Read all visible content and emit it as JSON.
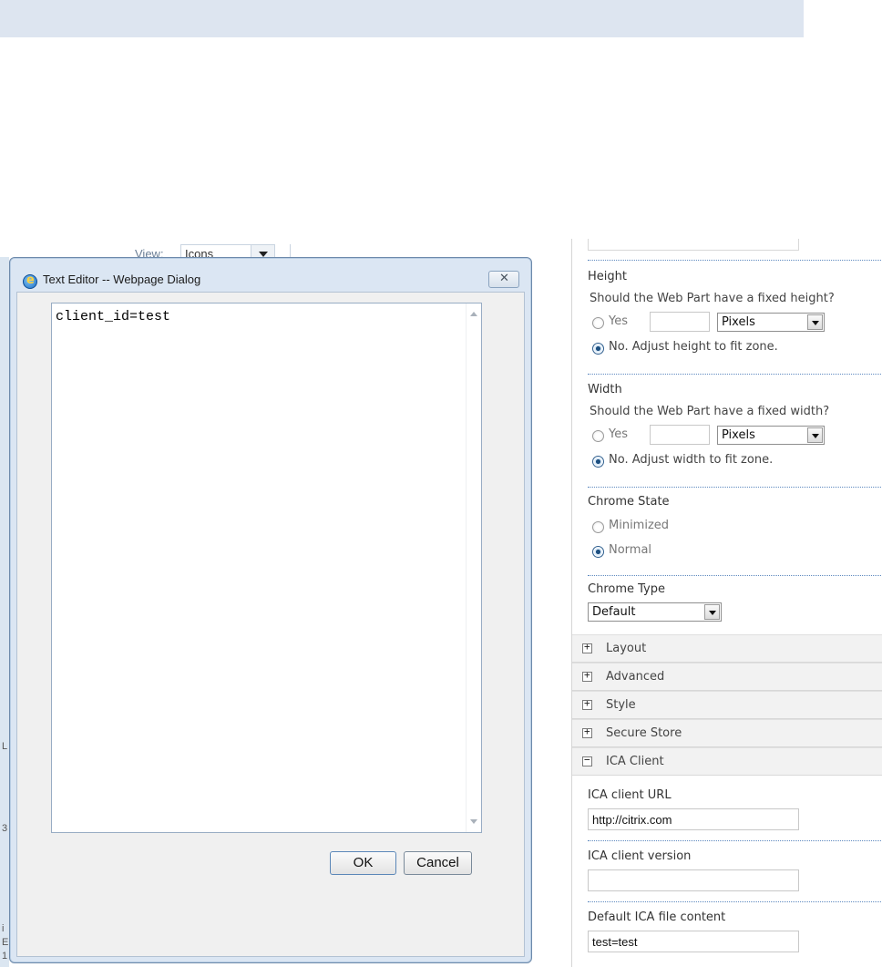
{
  "background": {
    "view_label": "View:",
    "view_value": "Icons",
    "edge_chars": [
      "L",
      "3",
      "i",
      "E",
      "1"
    ]
  },
  "dialog": {
    "title": "Text Editor -- Webpage Dialog",
    "close_label": "✕",
    "content": "client_id=test",
    "ok_label": "OK",
    "cancel_label": "Cancel"
  },
  "panel": {
    "height": {
      "heading": "Height",
      "question": "Should the Web Part have a fixed height?",
      "yes_label": "Yes",
      "unit": "Pixels",
      "no_label": "No. Adjust height to fit zone.",
      "selected": "no"
    },
    "width": {
      "heading": "Width",
      "question": "Should the Web Part have a fixed width?",
      "yes_label": "Yes",
      "unit": "Pixels",
      "no_label": "No. Adjust width to fit zone.",
      "selected": "no"
    },
    "chrome_state": {
      "heading": "Chrome State",
      "minimized_label": "Minimized",
      "normal_label": "Normal",
      "selected": "normal"
    },
    "chrome_type": {
      "heading": "Chrome Type",
      "value": "Default"
    },
    "sections": [
      {
        "symbol": "+",
        "label": "Layout"
      },
      {
        "symbol": "+",
        "label": "Advanced"
      },
      {
        "symbol": "+",
        "label": "Style"
      },
      {
        "symbol": "+",
        "label": "Secure Store"
      },
      {
        "symbol": "−",
        "label": "ICA Client"
      }
    ],
    "ica": {
      "url_label": "ICA client URL",
      "url_value": "http://citrix.com",
      "version_label": "ICA client version",
      "version_value": "",
      "file_label": "Default ICA file content",
      "file_value": "test=test"
    }
  }
}
